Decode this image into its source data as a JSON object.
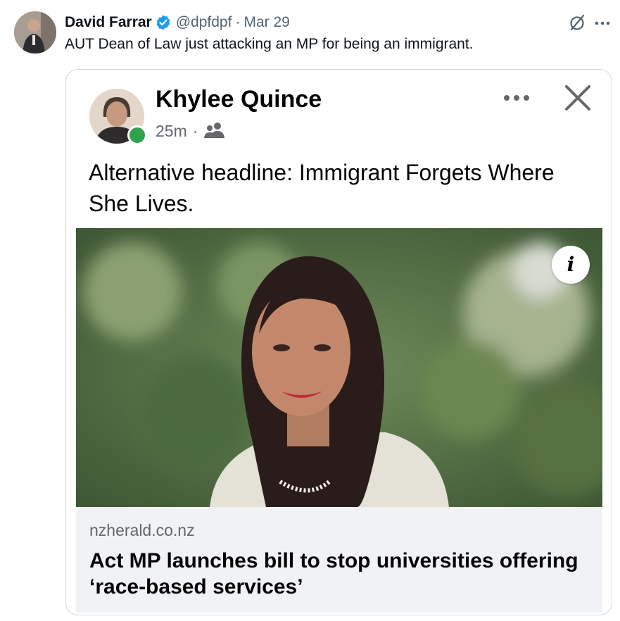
{
  "tweet": {
    "author_name": "David Farrar",
    "handle": "@dpfdpf",
    "separator": "·",
    "date": "Mar 29",
    "text": "AUT Dean of Law just attacking an MP for being an immigrant.",
    "icons": {
      "verified": "verified-badge-icon",
      "grok": "grok-icon",
      "more": "more-icon"
    }
  },
  "quoted_post": {
    "name": "Khylee Quince",
    "time": "25m",
    "separator": "·",
    "text": "Alternative headline: Immigrant Forgets Where She Lives.",
    "icons": {
      "audience": "friends-icon",
      "more": "more-icon",
      "close": "close-icon",
      "info": "info-icon"
    },
    "info_label": "i",
    "link": {
      "domain": "nzherald.co.nz",
      "headline": "Act MP launches bill to stop universities offering ‘race-based services’"
    }
  },
  "colors": {
    "verified_blue": "#1d9bf0",
    "online_green": "#31a24c",
    "secondary_text": "#536471",
    "link_panel_bg": "#f0f2f5"
  }
}
